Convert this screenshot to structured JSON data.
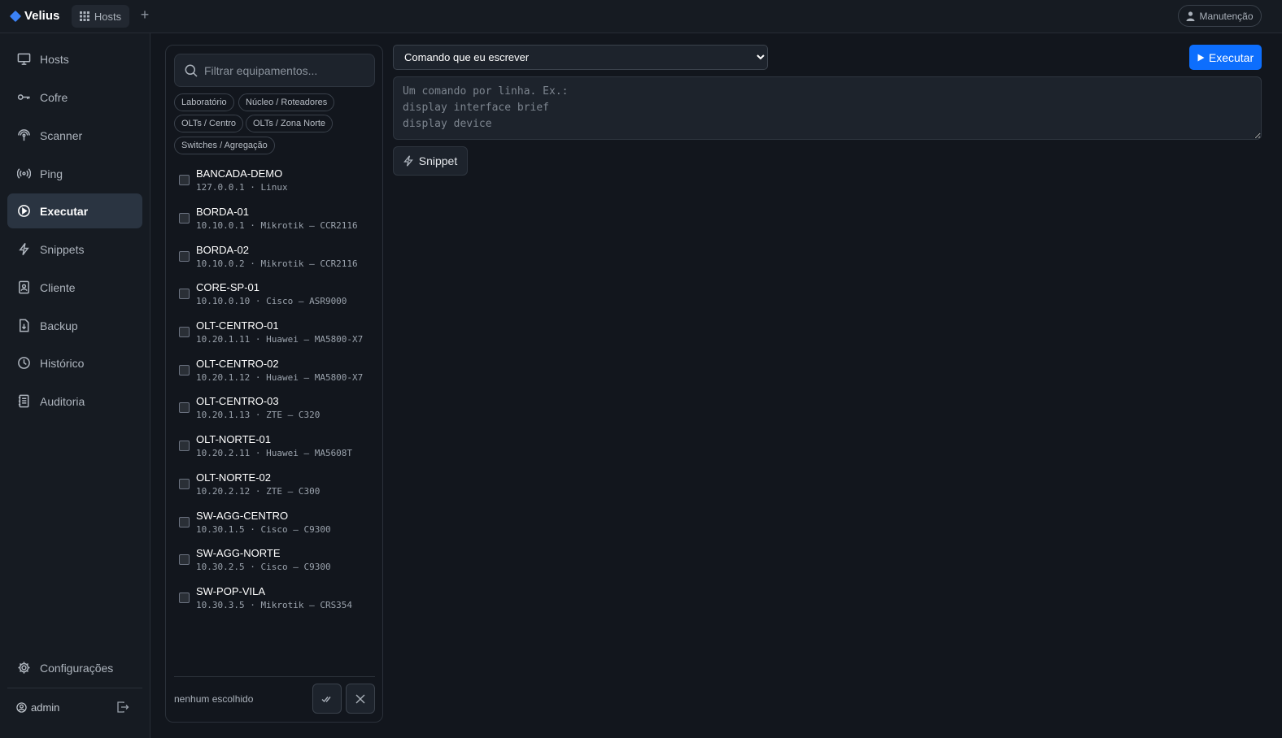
{
  "topbar": {
    "brand": "Velius",
    "tab_hosts": "Hosts",
    "tab_add": "+",
    "maintenance": "Manutenção"
  },
  "sidebar": {
    "items": [
      {
        "label": "Hosts",
        "icon": "monitor-icon"
      },
      {
        "label": "Cofre",
        "icon": "key-icon"
      },
      {
        "label": "Scanner",
        "icon": "radar-icon"
      },
      {
        "label": "Ping",
        "icon": "broadcast-icon"
      },
      {
        "label": "Executar",
        "icon": "play-circle-icon",
        "active": true
      },
      {
        "label": "Snippets",
        "icon": "lightning-icon"
      },
      {
        "label": "Cliente",
        "icon": "person-badge-icon"
      },
      {
        "label": "Backup",
        "icon": "file-arrow-icon"
      },
      {
        "label": "Histórico",
        "icon": "clock-icon"
      },
      {
        "label": "Auditoria",
        "icon": "journal-icon"
      }
    ],
    "settings": "Configurações",
    "user": "admin"
  },
  "hostpanel": {
    "search_placeholder": "Filtrar equipamentos...",
    "chips": [
      "Laboratório",
      "Núcleo / Roteadores",
      "OLTs / Centro",
      "OLTs / Zona Norte",
      "Switches / Agregação"
    ],
    "hosts": [
      {
        "name": "BANCADA-DEMO",
        "detail": "127.0.0.1 · Linux"
      },
      {
        "name": "BORDA-01",
        "detail": "10.10.0.1 · Mikrotik — CCR2116"
      },
      {
        "name": "BORDA-02",
        "detail": "10.10.0.2 · Mikrotik — CCR2116"
      },
      {
        "name": "CORE-SP-01",
        "detail": "10.10.0.10 · Cisco — ASR9000"
      },
      {
        "name": "OLT-CENTRO-01",
        "detail": "10.20.1.11 · Huawei — MA5800-X7"
      },
      {
        "name": "OLT-CENTRO-02",
        "detail": "10.20.1.12 · Huawei — MA5800-X7"
      },
      {
        "name": "OLT-CENTRO-03",
        "detail": "10.20.1.13 · ZTE — C320"
      },
      {
        "name": "OLT-NORTE-01",
        "detail": "10.20.2.11 · Huawei — MA5608T"
      },
      {
        "name": "OLT-NORTE-02",
        "detail": "10.20.2.12 · ZTE — C300"
      },
      {
        "name": "SW-AGG-CENTRO",
        "detail": "10.30.1.5 · Cisco — C9300"
      },
      {
        "name": "SW-AGG-NORTE",
        "detail": "10.30.2.5 · Cisco — C9300"
      },
      {
        "name": "SW-POP-VILA",
        "detail": "10.30.3.5 · Mikrotik — CRS354"
      }
    ],
    "chosen_text": "nenhum escolhido"
  },
  "main": {
    "command_mode": "Comando que eu escrever",
    "run_label": "Executar",
    "command_placeholder": "Um comando por linha. Ex.:\ndisplay interface brief\ndisplay device",
    "snippet_label": "Snippet"
  },
  "colors": {
    "accent": "#0d6efd",
    "brand_icon": "#3b82f6",
    "background": "#12161d",
    "sidebar": "#161b22",
    "active_item": "#2a3441"
  }
}
